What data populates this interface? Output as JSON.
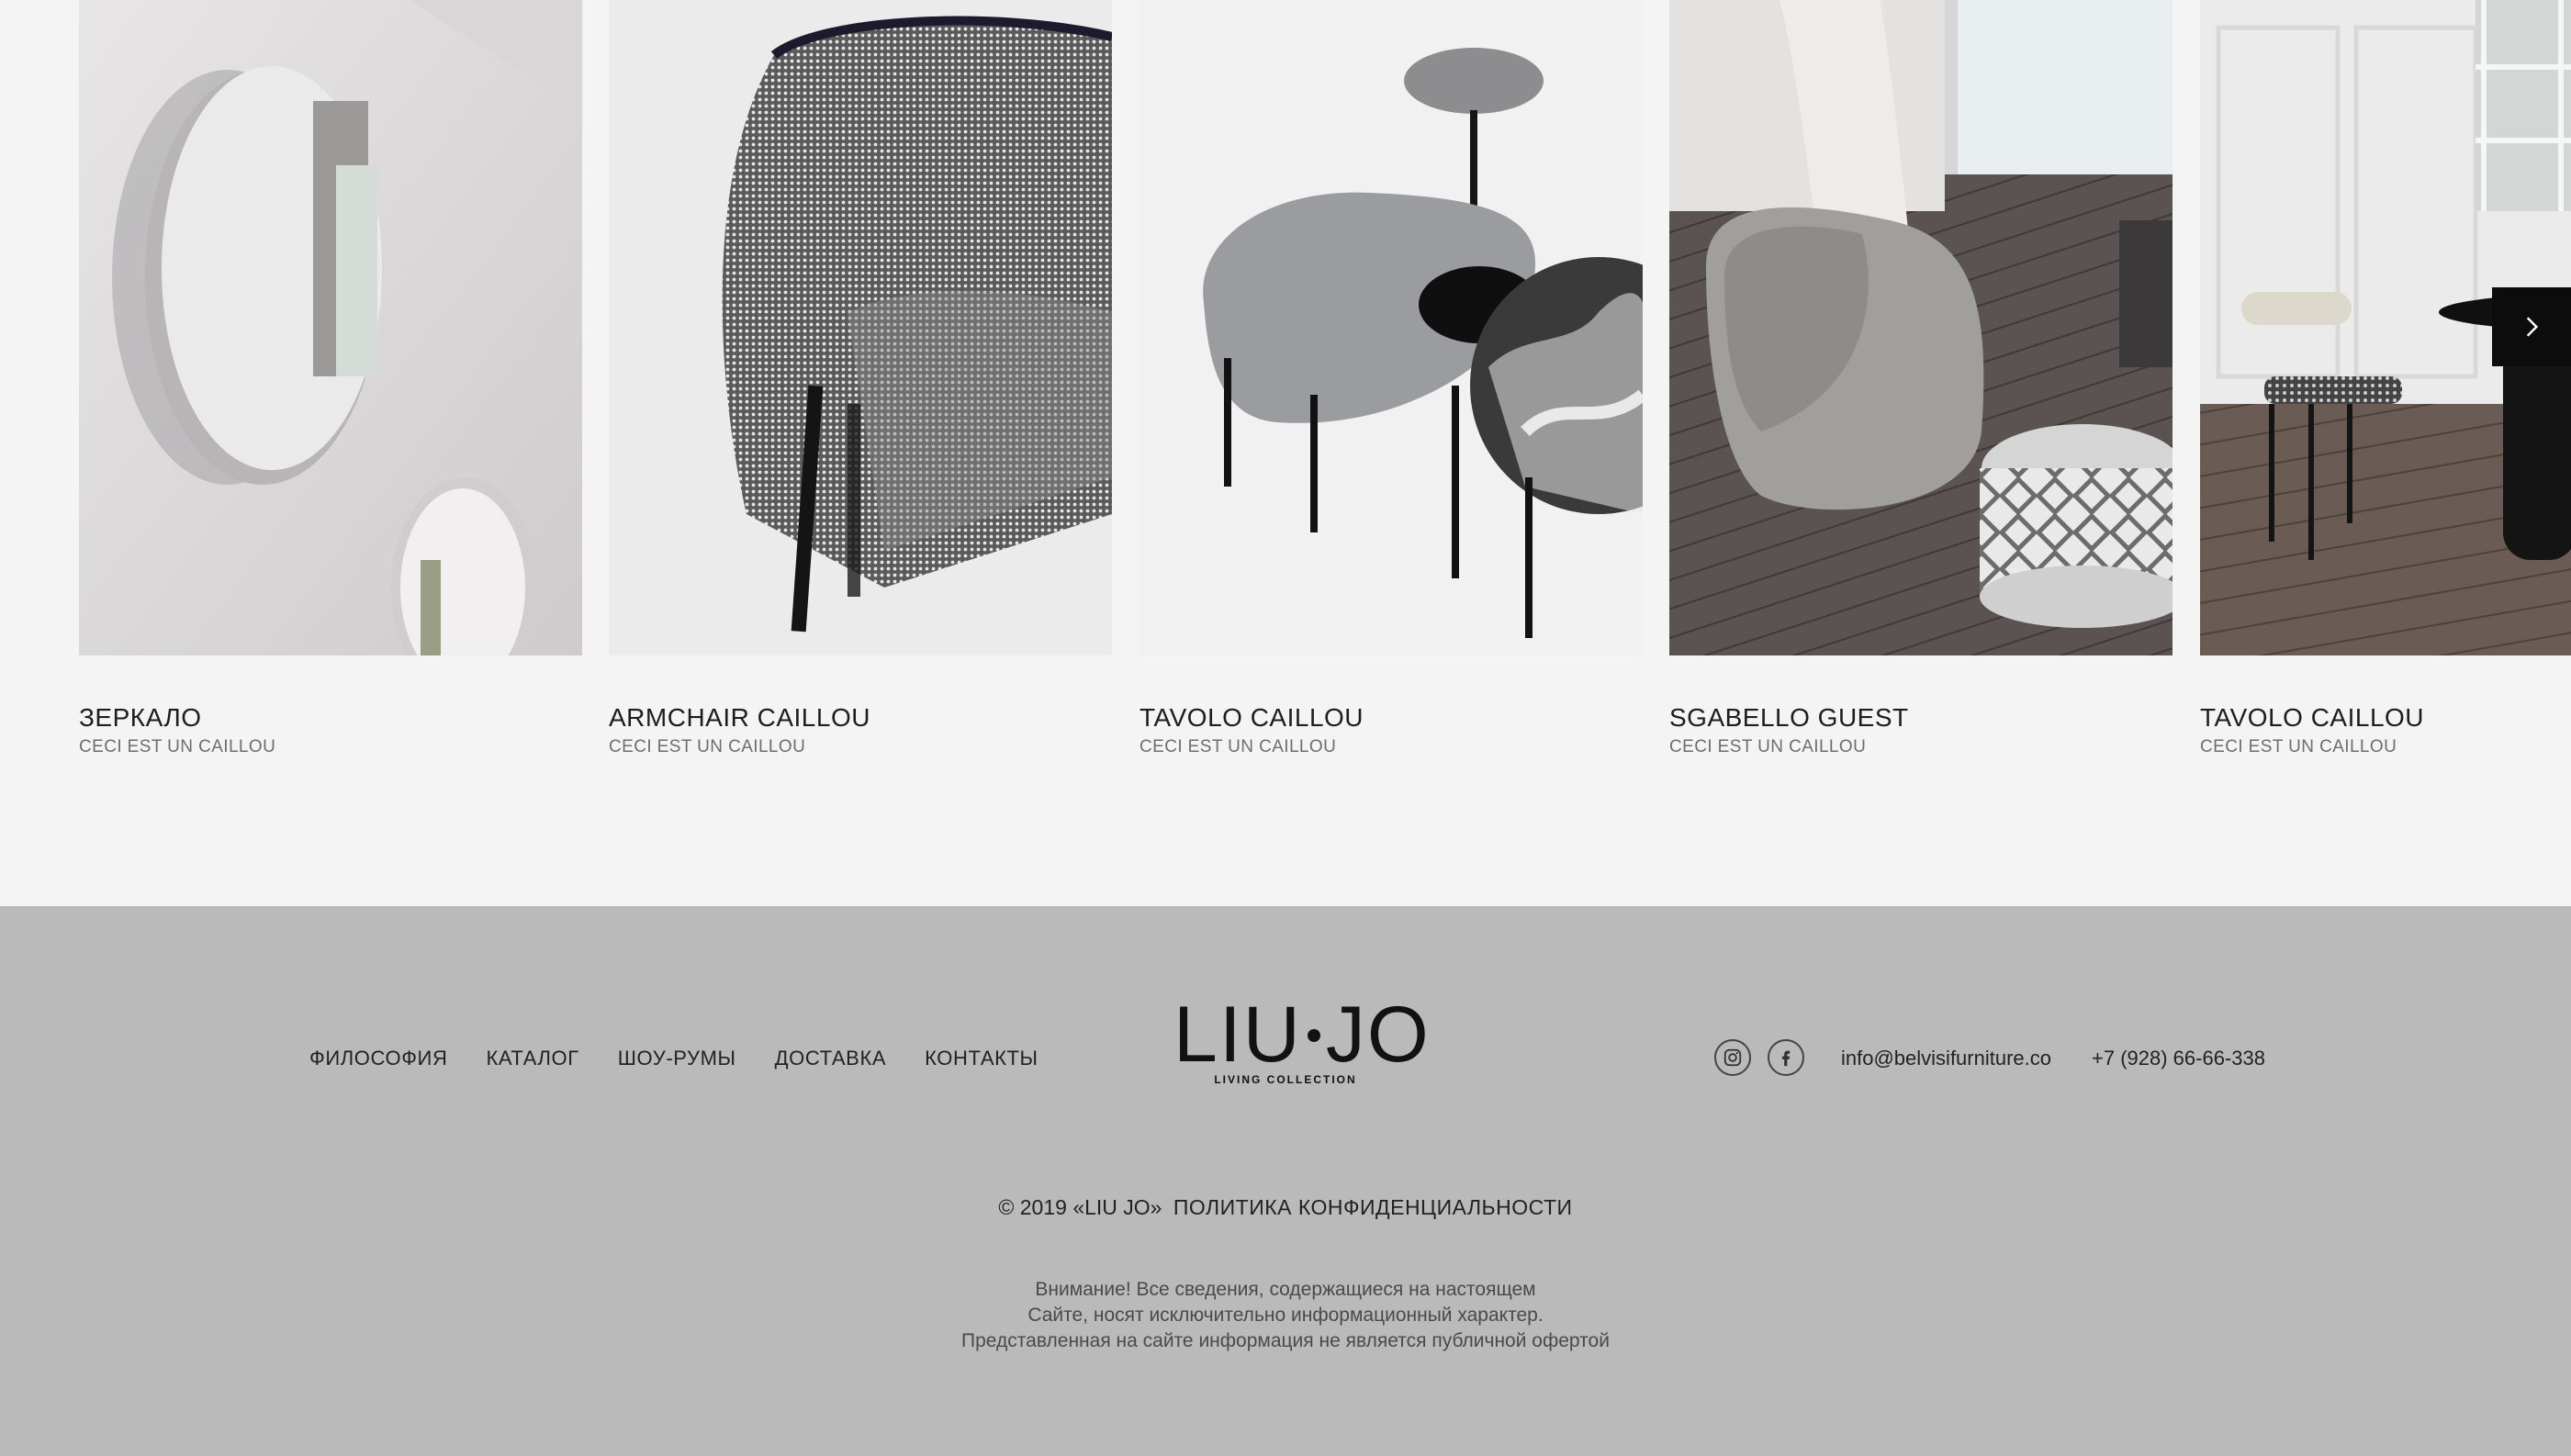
{
  "products": [
    {
      "title": "ЗЕРКАЛО",
      "subtitle": "CECI EST UN  CAILLOU"
    },
    {
      "title": "ARMCHAIR CAILLOU",
      "subtitle": "CECI EST UN  CAILLOU"
    },
    {
      "title": "TAVOLO CAILLOU",
      "subtitle": "CECI EST UN  CAILLOU"
    },
    {
      "title": "SGABELLO GUEST",
      "subtitle": "CECI EST UN  CAILLOU"
    },
    {
      "title": "TAVOLO CAILLOU",
      "subtitle": "CECI EST UN  CAILLOU"
    }
  ],
  "carousel": {
    "next_icon": "chevron-right-icon"
  },
  "footer": {
    "nav": [
      "ФИЛОСОФИЯ",
      "КАТАЛОГ",
      "ШОУ-РУМЫ",
      "ДОСТАВКА",
      "КОНТАКТЫ"
    ],
    "logo": {
      "left": "LIU",
      "right": "JO",
      "sub": "LIVING COLLECTION"
    },
    "social": [
      "instagram-icon",
      "facebook-icon"
    ],
    "email": "info@belvisifurniture.co",
    "phone": "+7 (928) 66-66-338",
    "copyright": "© 2019 «LIU JO»",
    "policy": "ПОЛИТИКА КОНФИДЕНЦИАЛЬНОСТИ",
    "notice": [
      "Внимание! Все сведения, содержащиеся на настоящем",
      "Сайте, носят исключительно информационный характер.",
      "Представленная на сайте информация не является публичной офертой"
    ]
  }
}
